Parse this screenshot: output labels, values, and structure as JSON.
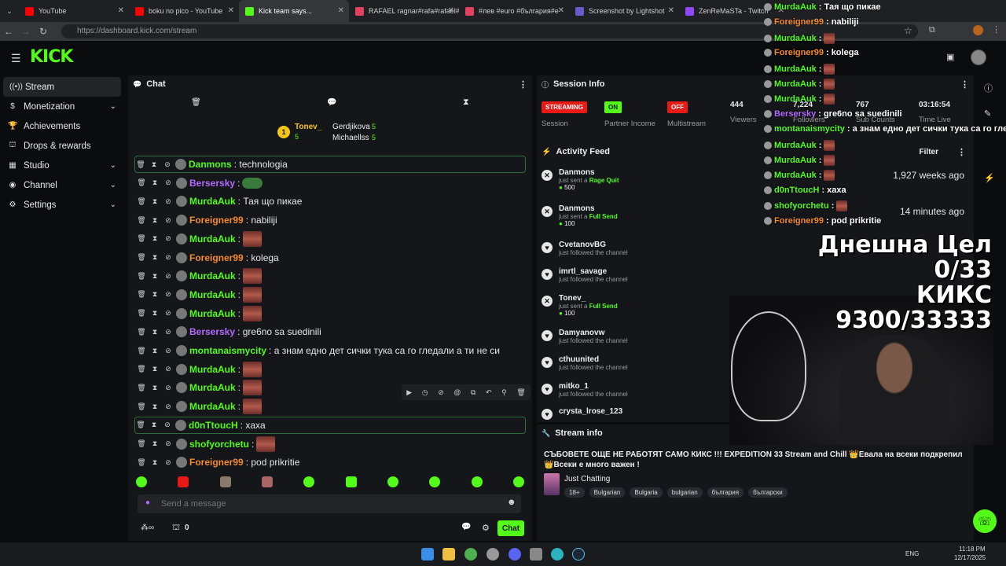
{
  "browser": {
    "tabs": [
      {
        "title": "YouTube",
        "color": "#ff0000"
      },
      {
        "title": "boku no pico - YouTube",
        "color": "#ff0000"
      },
      {
        "title": "Kick team says...",
        "color": "#53fc18"
      },
      {
        "title": "RAFAEL ragnar#rafa#rafael#",
        "color": "#e4405f"
      },
      {
        "title": "#лев #euro #българия#е",
        "color": "#e4405f"
      },
      {
        "title": "Screenshot by Lightshot",
        "color": "#6a5acd"
      },
      {
        "title": "ZenReMaSTa - Twitch",
        "color": "#9146ff"
      }
    ],
    "url": "https://dashboard.kick.com/stream"
  },
  "sidebar": {
    "items": [
      {
        "label": "Stream",
        "icon": "broadcast-icon"
      },
      {
        "label": "Monetization",
        "icon": "dollar-icon"
      },
      {
        "label": "Achievements",
        "icon": "trophy-icon"
      },
      {
        "label": "Drops & rewards",
        "icon": "gift-icon"
      },
      {
        "label": "Studio",
        "icon": "grid-icon"
      },
      {
        "label": "Channel",
        "icon": "user-icon"
      },
      {
        "label": "Settings",
        "icon": "gear-icon"
      }
    ]
  },
  "chat": {
    "title": "Chat",
    "leaderboard": [
      {
        "name": "Tonev_",
        "count": "5",
        "rank": "1"
      },
      {
        "name": "Gerdjikova",
        "count": "5"
      },
      {
        "name": "Michaellss",
        "count": "5"
      }
    ],
    "messages": [
      {
        "user": "Danmons",
        "color": "#53fc18",
        "text": ": technologia"
      },
      {
        "user": "Bersersky",
        "color": "#b36bff",
        "text": ":"
      },
      {
        "user": "MurdaAuk",
        "color": "#53fc18",
        "text": ": Тая що пикае"
      },
      {
        "user": "Foreigner99",
        "color": "#f48a2b",
        "text": ": nabiliji"
      },
      {
        "user": "MurdaAuk",
        "color": "#53fc18",
        "text": ":"
      },
      {
        "user": "Foreigner99",
        "color": "#f48a2b",
        "text": ": kolega"
      },
      {
        "user": "MurdaAuk",
        "color": "#53fc18",
        "text": ":"
      },
      {
        "user": "MurdaAuk",
        "color": "#53fc18",
        "text": ":"
      },
      {
        "user": "MurdaAuk",
        "color": "#53fc18",
        "text": ":"
      },
      {
        "user": "Bersersky",
        "color": "#b36bff",
        "text": ": gre6no sa suedinili"
      },
      {
        "user": "montanaismycity",
        "color": "#53fc18",
        "text": ": а знам едно дет сички тука са го гледали а ти не си"
      },
      {
        "user": "MurdaAuk",
        "color": "#53fc18",
        "text": ":"
      },
      {
        "user": "MurdaAuk",
        "color": "#53fc18",
        "text": ":"
      },
      {
        "user": "MurdaAuk",
        "color": "#53fc18",
        "text": ":"
      },
      {
        "user": "d0nTtoucH",
        "color": "#53fc18",
        "text": ": xaxa"
      },
      {
        "user": "shofyorchetu",
        "color": "#53fc18",
        "text": ":"
      },
      {
        "user": "Foreigner99",
        "color": "#f48a2b",
        "text": ": pod prikritie"
      }
    ],
    "input_placeholder": "Send a message",
    "footer_count": "0",
    "send_label": "Chat"
  },
  "session": {
    "title": "Session Info",
    "stats": [
      {
        "badge": "STREAMING",
        "badge_color": "#e91916",
        "label": "Session"
      },
      {
        "badge": "ON",
        "badge_color": "#53fc18",
        "label": "Partner Income"
      },
      {
        "badge": "OFF",
        "badge_color": "#e91916",
        "label": "Multistream"
      },
      {
        "value": "444",
        "label": "Viewers"
      },
      {
        "value": "7,224",
        "label": "Followers"
      },
      {
        "value": "767",
        "label": "Sub Counts"
      },
      {
        "value": "03:16:54",
        "label": "Time Live"
      }
    ]
  },
  "activity": {
    "title": "Activity Feed",
    "filter": "Filter",
    "items": [
      {
        "name": "Danmons",
        "sub": "just sent a",
        "action": "Rage Quit",
        "amount": "500",
        "time": "1,927 weeks ago",
        "type": "kick"
      },
      {
        "name": "Danmons",
        "sub": "just sent a",
        "action": "Full Send",
        "amount": "100",
        "time": "14 minutes ago",
        "type": "kick"
      },
      {
        "name": "CvetanovBG",
        "sub": "just followed the channel",
        "type": "heart"
      },
      {
        "name": "imrtl_savage",
        "sub": "just followed the channel",
        "type": "heart"
      },
      {
        "name": "Tonev_",
        "sub": "just sent a",
        "action": "Full Send",
        "amount": "100",
        "type": "kick"
      },
      {
        "name": "Damyanovw",
        "sub": "just followed the channel",
        "type": "heart"
      },
      {
        "name": "cthuunited",
        "sub": "just followed the channel",
        "type": "heart"
      },
      {
        "name": "mitko_1",
        "sub": "just followed the channel",
        "type": "heart"
      },
      {
        "name": "crysta_lrose_123",
        "sub": "",
        "type": "heart"
      }
    ]
  },
  "stream_info": {
    "title_label": "Stream info",
    "stream_title": "СЪБОВЕТЕ ОЩЕ НЕ РАБОТЯТ САМО КИКС !!! EXPEDITION 33 Stream and Chill 👑Евала на всеки подкрепил👑Всеки е много важен !",
    "category": "Just Chatting",
    "tags": [
      "18+",
      "Bulgarian",
      "Bulgaria",
      "bulgarian",
      "българия",
      "български"
    ]
  },
  "overlay": {
    "goal_line1": "Днешна Цел 0/33",
    "goal_line2": "КИКС 9300/33333",
    "chat": [
      {
        "user": "MurdaAuk",
        "color": "#53fc18",
        "text": ": Тая що пикае"
      },
      {
        "user": "Foreigner99",
        "color": "#f48a2b",
        "text": ": nabiliji"
      },
      {
        "user": "MurdaAuk",
        "color": "#53fc18",
        "text": ":"
      },
      {
        "user": "Foreigner99",
        "color": "#f48a2b",
        "text": ": kolega"
      },
      {
        "user": "MurdaAuk",
        "color": "#53fc18",
        "text": ":"
      },
      {
        "user": "MurdaAuk",
        "color": "#53fc18",
        "text": ":"
      },
      {
        "user": "MurdaAuk",
        "color": "#53fc18",
        "text": ":"
      },
      {
        "user": "Bersersky",
        "color": "#b36bff",
        "text": ": gre6no sa suedinili"
      },
      {
        "user": "montanaismycity",
        "color": "#53fc18",
        "text": ": а знам едно дет сички тука са го гле"
      },
      {
        "user": "MurdaAuk",
        "color": "#53fc18",
        "text": ":"
      },
      {
        "user": "MurdaAuk",
        "color": "#53fc18",
        "text": ":"
      },
      {
        "user": "MurdaAuk",
        "color": "#53fc18",
        "text": ":"
      },
      {
        "user": "d0nTtoucH",
        "color": "#53fc18",
        "text": ": xaxa"
      },
      {
        "user": "shofyorchetu",
        "color": "#53fc18",
        "text": ":"
      },
      {
        "user": "Foreigner99",
        "color": "#f48a2b",
        "text": ": pod prikritie"
      }
    ]
  },
  "taskbar": {
    "lang": "ENG",
    "time": "11:18 PM",
    "date": "12/17/2025"
  }
}
